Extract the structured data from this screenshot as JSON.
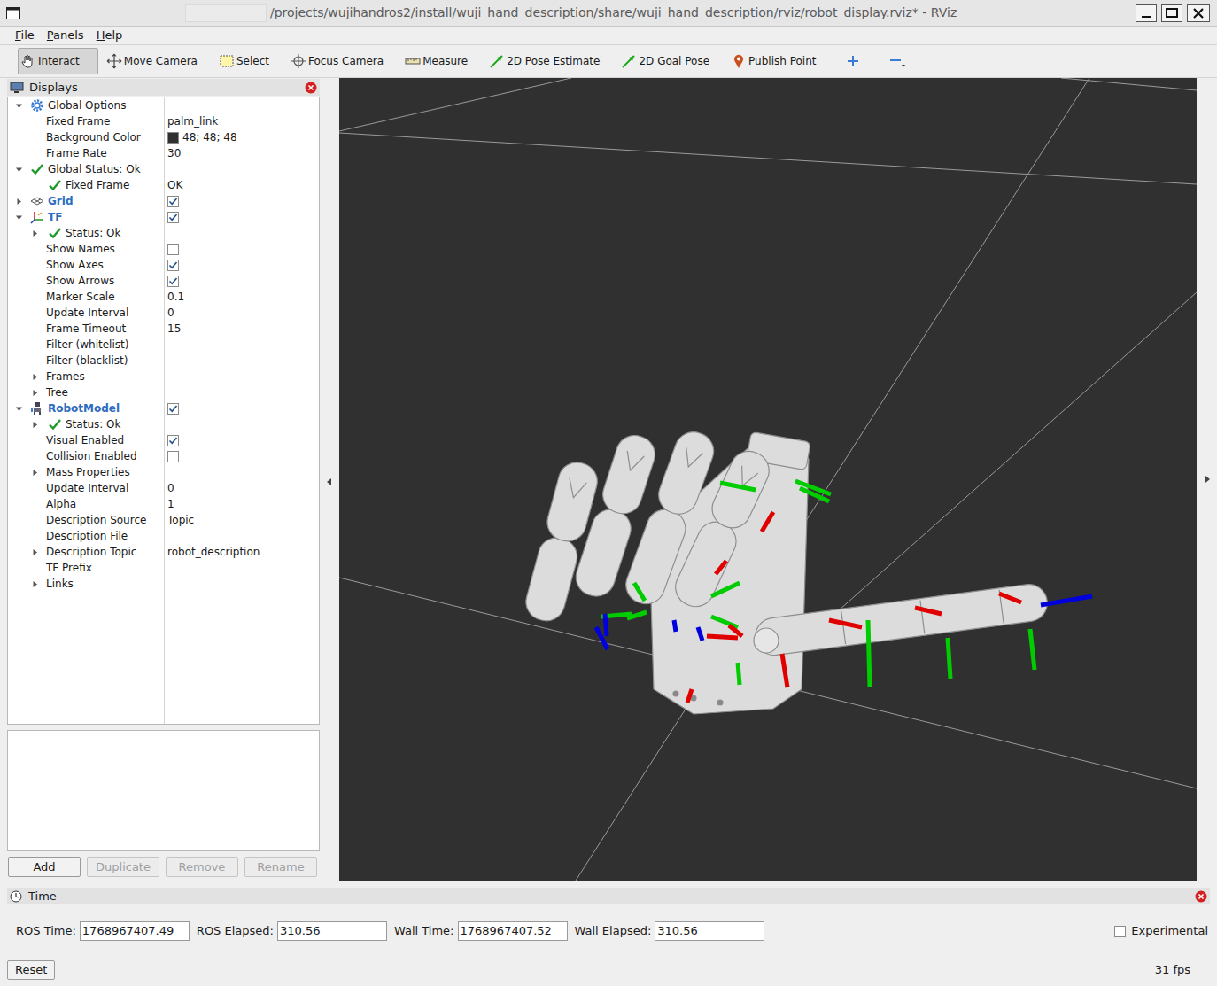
{
  "window": {
    "title": "/projects/wujihandros2/install/wuji_hand_description/share/wuji_hand_description/rviz/robot_display.rviz* - RViz"
  },
  "menu": [
    "File",
    "Panels",
    "Help"
  ],
  "toolbar": [
    {
      "label": "Interact",
      "kind": "interact",
      "selected": true
    },
    {
      "label": "Move Camera",
      "kind": "move",
      "selected": false
    },
    {
      "label": "Select",
      "kind": "select",
      "selected": false
    },
    {
      "label": "Focus Camera",
      "kind": "focus",
      "selected": false
    },
    {
      "label": "Measure",
      "kind": "measure",
      "selected": false
    },
    {
      "label": "2D Pose Estimate",
      "kind": "pose",
      "selected": false
    },
    {
      "label": "2D Goal Pose",
      "kind": "goal",
      "selected": false
    },
    {
      "label": "Publish Point",
      "kind": "point",
      "selected": false
    }
  ],
  "displays": {
    "title": "Displays",
    "items": [
      {
        "name": "Global Options",
        "kind": "options",
        "expanded": true,
        "children": [
          {
            "name": "Fixed Frame",
            "kind": "property",
            "value": "palm_link"
          },
          {
            "name": "Background Color",
            "kind": "color",
            "value": "48; 48; 48",
            "color": "#303030"
          },
          {
            "name": "Frame Rate",
            "kind": "property",
            "value": "30"
          }
        ]
      },
      {
        "name": "Global Status: Ok",
        "kind": "status",
        "expanded": true,
        "children": [
          {
            "name": "Fixed Frame",
            "kind": "status",
            "value": "OK"
          }
        ]
      },
      {
        "name": "Grid",
        "kind": "grid",
        "expanded": false,
        "checked": true
      },
      {
        "name": "TF",
        "kind": "tf",
        "expanded": true,
        "checked": true,
        "children": [
          {
            "name": "Status: Ok",
            "kind": "status",
            "expanded": false
          },
          {
            "name": "Show Names",
            "kind": "checkbox",
            "checked": false
          },
          {
            "name": "Show Axes",
            "kind": "checkbox",
            "checked": true
          },
          {
            "name": "Show Arrows",
            "kind": "checkbox",
            "checked": true
          },
          {
            "name": "Marker Scale",
            "kind": "property",
            "value": "0.1"
          },
          {
            "name": "Update Interval",
            "kind": "property",
            "value": "0"
          },
          {
            "name": "Frame Timeout",
            "kind": "property",
            "value": "15"
          },
          {
            "name": "Filter (whitelist)",
            "kind": "property"
          },
          {
            "name": "Filter (blacklist)",
            "kind": "property"
          },
          {
            "name": "Frames",
            "kind": "property",
            "expanded": false
          },
          {
            "name": "Tree",
            "kind": "property",
            "expanded": false
          }
        ]
      },
      {
        "name": "RobotModel",
        "kind": "robot",
        "expanded": true,
        "checked": true,
        "children": [
          {
            "name": "Status: Ok",
            "kind": "status",
            "expanded": false
          },
          {
            "name": "Visual Enabled",
            "kind": "checkbox",
            "checked": true
          },
          {
            "name": "Collision Enabled",
            "kind": "checkbox",
            "checked": false
          },
          {
            "name": "Mass Properties",
            "kind": "property",
            "expanded": false
          },
          {
            "name": "Update Interval",
            "kind": "property",
            "value": "0"
          },
          {
            "name": "Alpha",
            "kind": "property",
            "value": "1"
          },
          {
            "name": "Description Source",
            "kind": "property",
            "value": "Topic"
          },
          {
            "name": "Description File",
            "kind": "property"
          },
          {
            "name": "Description Topic",
            "kind": "property",
            "value": "robot_description",
            "expanded": false
          },
          {
            "name": "TF Prefix",
            "kind": "property"
          },
          {
            "name": "Links",
            "kind": "property",
            "expanded": false
          }
        ]
      }
    ]
  },
  "buttons": [
    {
      "label": "Add",
      "disabled": false
    },
    {
      "label": "Duplicate",
      "disabled": true
    },
    {
      "label": "Remove",
      "disabled": true
    },
    {
      "label": "Rename",
      "disabled": true
    }
  ],
  "time_panel": {
    "title": "Time",
    "fields": [
      {
        "label": "ROS Time:",
        "value": "1768967407.49"
      },
      {
        "label": "ROS Elapsed:",
        "value": "310.56"
      },
      {
        "label": "Wall Time:",
        "value": "1768967407.52"
      },
      {
        "label": "Wall Elapsed:",
        "value": "310.56"
      }
    ],
    "experimental": {
      "label": "Experimental",
      "checked": false
    },
    "reset": "Reset",
    "fps": "31 fps"
  }
}
